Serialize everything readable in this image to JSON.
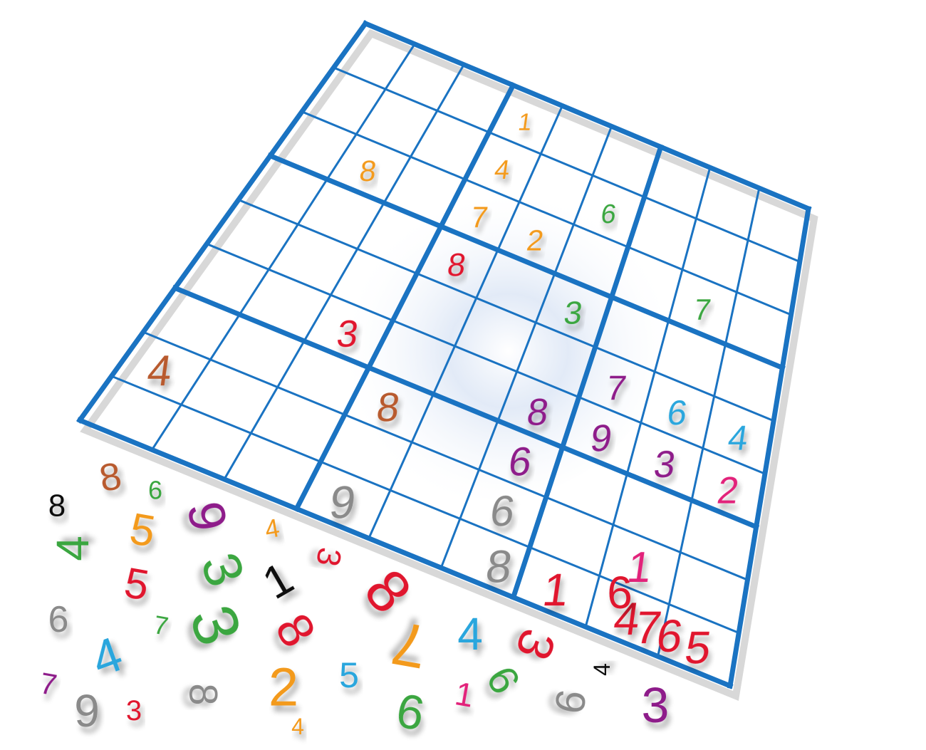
{
  "grid": {
    "rows": 9,
    "cols": 9,
    "line_color": "#1a73c2",
    "cells": [
      {
        "r": 0,
        "c": 3,
        "v": "1",
        "color": "#f39a1e"
      },
      {
        "r": 1,
        "c": 3,
        "v": "4",
        "color": "#f39a1e"
      },
      {
        "r": 1,
        "c": 5,
        "v": "6",
        "color": "#3aa640"
      },
      {
        "r": 2,
        "c": 1,
        "v": "8",
        "color": "#f39a1e"
      },
      {
        "r": 2,
        "c": 3,
        "v": "7",
        "color": "#f39a1e"
      },
      {
        "r": 2,
        "c": 4,
        "v": "2",
        "color": "#f39a1e"
      },
      {
        "r": 2,
        "c": 7,
        "v": "7",
        "color": "#3aa640"
      },
      {
        "r": 3,
        "c": 3,
        "v": "8",
        "color": "#e0182e"
      },
      {
        "r": 3,
        "c": 5,
        "v": "3",
        "color": "#3aa640"
      },
      {
        "r": 4,
        "c": 8,
        "v": "4",
        "color": "#2aa6dd"
      },
      {
        "r": 4,
        "c": 6,
        "v": "7",
        "color": "#8e1f8a"
      },
      {
        "r": 4,
        "c": 7,
        "v": "6",
        "color": "#2aa6dd"
      },
      {
        "r": 5,
        "c": 2,
        "v": "3",
        "color": "#e0182e"
      },
      {
        "r": 5,
        "c": 5,
        "v": "8",
        "color": "#8e1f8a"
      },
      {
        "r": 5,
        "c": 6,
        "v": "9",
        "color": "#8e1f8a"
      },
      {
        "r": 5,
        "c": 7,
        "v": "3",
        "color": "#8e1f8a"
      },
      {
        "r": 5,
        "c": 8,
        "v": "2",
        "color": "#e2207a"
      },
      {
        "r": 6,
        "c": 3,
        "v": "8",
        "color": "#b85a2e"
      },
      {
        "r": 6,
        "c": 5,
        "v": "6",
        "color": "#8e1f8a"
      },
      {
        "r": 7,
        "c": 0,
        "v": "4",
        "color": "#b85a2e"
      },
      {
        "r": 7,
        "c": 5,
        "v": "6",
        "color": "#8a8a8a"
      },
      {
        "r": 7,
        "c": 7,
        "v": "1",
        "color": "#e2207a"
      },
      {
        "r": 8,
        "c": 3,
        "v": "9",
        "color": "#8a8a8a"
      },
      {
        "r": 8,
        "c": 6,
        "v": "1",
        "color": "#e0182e"
      },
      {
        "r": 8,
        "c": 7,
        "v": "4",
        "color": "#e0182e"
      },
      {
        "r": 8,
        "c": 8,
        "v": "5",
        "color": "#e0182e"
      },
      {
        "r": 8,
        "c": 7.3,
        "v": "7",
        "color": "#e0182e"
      },
      {
        "r": 8,
        "c": 5.2,
        "v": "8",
        "color": "#8a8a8a"
      },
      {
        "r": 8,
        "c": 7.6,
        "v": "6",
        "color": "#e0182e"
      }
    ]
  },
  "scattered_digits": [
    {
      "v": "8",
      "color": "#111111"
    },
    {
      "v": "8",
      "color": "#b85a2e"
    },
    {
      "v": "6",
      "color": "#3aa640"
    },
    {
      "v": "5",
      "color": "#f39a1e"
    },
    {
      "v": "9",
      "color": "#8e1f8a"
    },
    {
      "v": "4",
      "color": "#3aa640"
    },
    {
      "v": "4",
      "color": "#f39a1e"
    },
    {
      "v": "3",
      "color": "#e0182e"
    },
    {
      "v": "5",
      "color": "#e0182e"
    },
    {
      "v": "3",
      "color": "#3aa640"
    },
    {
      "v": "1",
      "color": "#111111"
    },
    {
      "v": "8",
      "color": "#e0182e"
    },
    {
      "v": "6",
      "color": "#8a8a8a"
    },
    {
      "v": "7",
      "color": "#3aa640"
    },
    {
      "v": "3",
      "color": "#3aa640"
    },
    {
      "v": "8",
      "color": "#e0182e"
    },
    {
      "v": "7",
      "color": "#f39a1e"
    },
    {
      "v": "4",
      "color": "#2aa6dd"
    },
    {
      "v": "3",
      "color": "#e0182e"
    },
    {
      "v": "4",
      "color": "#2aa6dd"
    },
    {
      "v": "5",
      "color": "#2aa6dd"
    },
    {
      "v": "2",
      "color": "#f39a1e"
    },
    {
      "v": "6",
      "color": "#3aa640"
    },
    {
      "v": "1",
      "color": "#e2207a"
    },
    {
      "v": "6",
      "color": "#3aa640"
    },
    {
      "v": "4",
      "color": "#111111"
    },
    {
      "v": "9",
      "color": "#8a8a8a"
    },
    {
      "v": "3",
      "color": "#8e1f8a"
    },
    {
      "v": "7",
      "color": "#8e1f8a"
    },
    {
      "v": "9",
      "color": "#8a8a8a"
    },
    {
      "v": "3",
      "color": "#e0182e"
    },
    {
      "v": "8",
      "color": "#8a8a8a"
    },
    {
      "v": "4",
      "color": "#f39a1e"
    },
    {
      "v": "6",
      "color": "#e0182e"
    }
  ]
}
